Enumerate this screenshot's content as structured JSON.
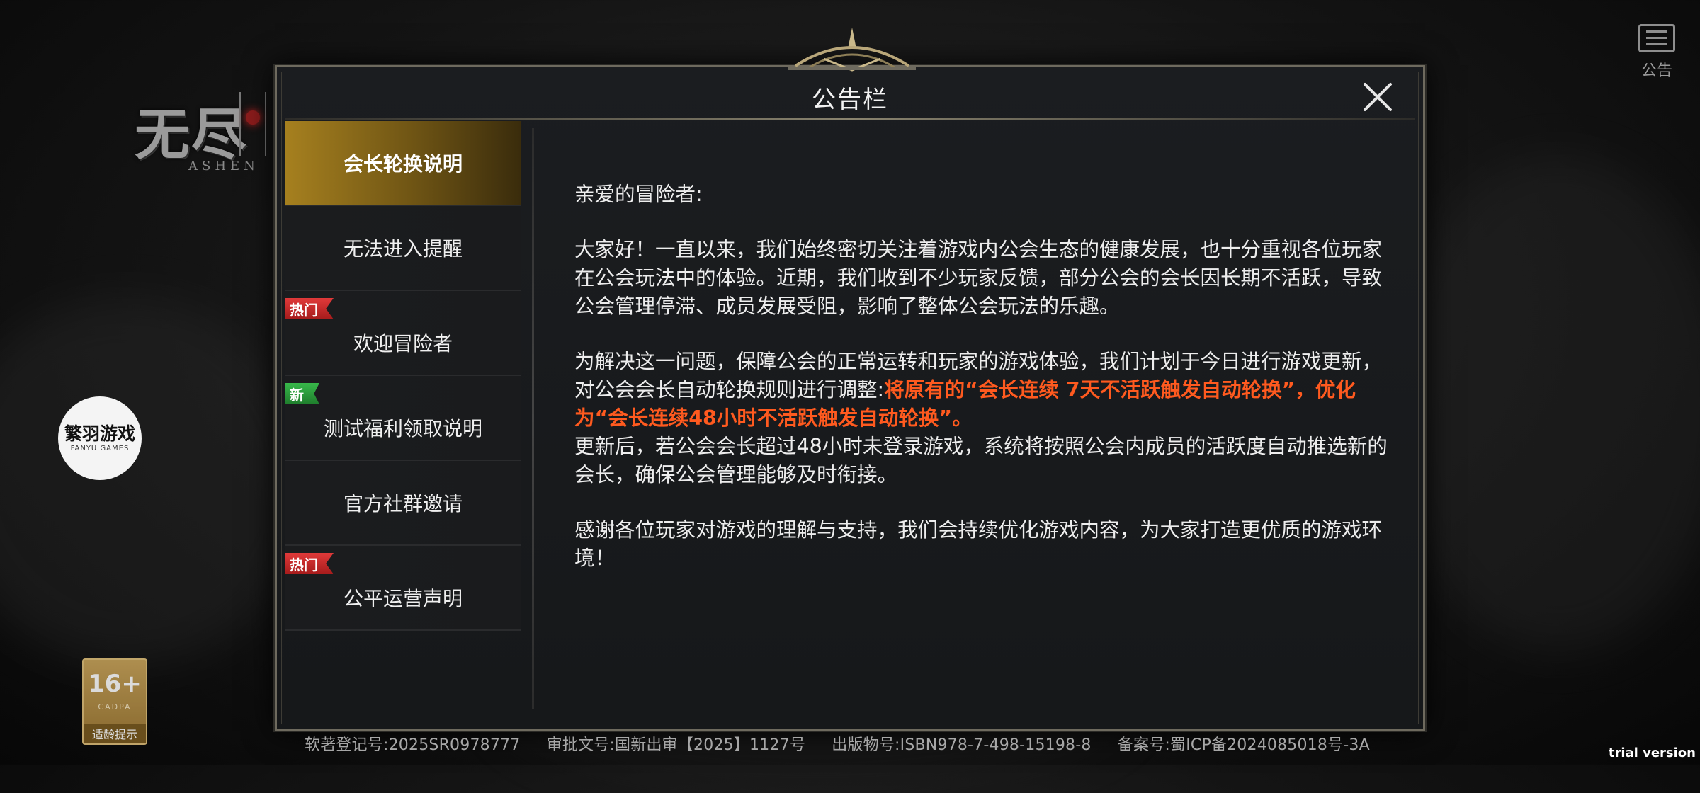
{
  "background": {
    "logo_text": "无尽",
    "logo_sub": "ASHEN"
  },
  "publisher": {
    "name": "繁羽游戏",
    "sub": "FANYU GAMES"
  },
  "age_rating": {
    "number": "16+",
    "org": "CADPA",
    "tip": "适龄提示"
  },
  "notice_button": {
    "label": "公告",
    "icon": "notice-list-icon"
  },
  "dialog": {
    "title": "公告栏",
    "tabs": [
      {
        "label": "会长轮换说明",
        "active": true,
        "badge": ""
      },
      {
        "label": "无法进入提醒",
        "active": false,
        "badge": ""
      },
      {
        "label": "欢迎冒险者",
        "active": false,
        "badge": "热门",
        "badge_type": "hot"
      },
      {
        "label": "测试福利领取说明",
        "active": false,
        "badge": "新",
        "badge_type": "new"
      },
      {
        "label": "官方社群邀请",
        "active": false,
        "badge": ""
      },
      {
        "label": "公平运营声明",
        "active": false,
        "badge": "热门",
        "badge_type": "hot"
      }
    ],
    "content": {
      "greeting": "亲爱的冒险者:",
      "para1": "大家好！一直以来，我们始终密切关注着游戏内公会生态的健康发展，也十分重视各位玩家在公会玩法中的体验。近期，我们收到不少玩家反馈，部分公会的会长因长期不活跃，导致公会管理停滞、成员发展受阻，影响了整体公会玩法的乐趣。",
      "para2_start": "为解决这一问题，保障公会的正常运转和玩家的游戏体验，我们计划于今日进行游戏更新，对公会会长自动轮换规则进行调整:",
      "para2_highlight": "将原有的“会长连续 7天不活跃触发自动轮换”，优化为“会长连续48小时不活跃触发自动轮换”。",
      "para2_end": "更新后，若公会会长超过48小时未登录游戏，系统将按照公会内成员的活跃度自动推选新的会长，确保公会管理能够及时衔接。",
      "para3": "感谢各位玩家对游戏的理解与支持，我们会持续优化游戏内容，为大家打造更优质的游戏环境！"
    }
  },
  "footer": {
    "software_reg": "软著登记号:2025SR0978777",
    "approval": "审批文号:国新出审【2025】1127号",
    "publication": "出版物号:ISBN978-7-498-15198-8",
    "icp": "备案号:蜀ICP备2024085018号-3A"
  },
  "watermark": "trial version",
  "colors": {
    "accent_gold": "#a6801f",
    "highlight": "#ff5a1f",
    "hot_badge": "#e03a3a",
    "new_badge": "#38b84a"
  }
}
